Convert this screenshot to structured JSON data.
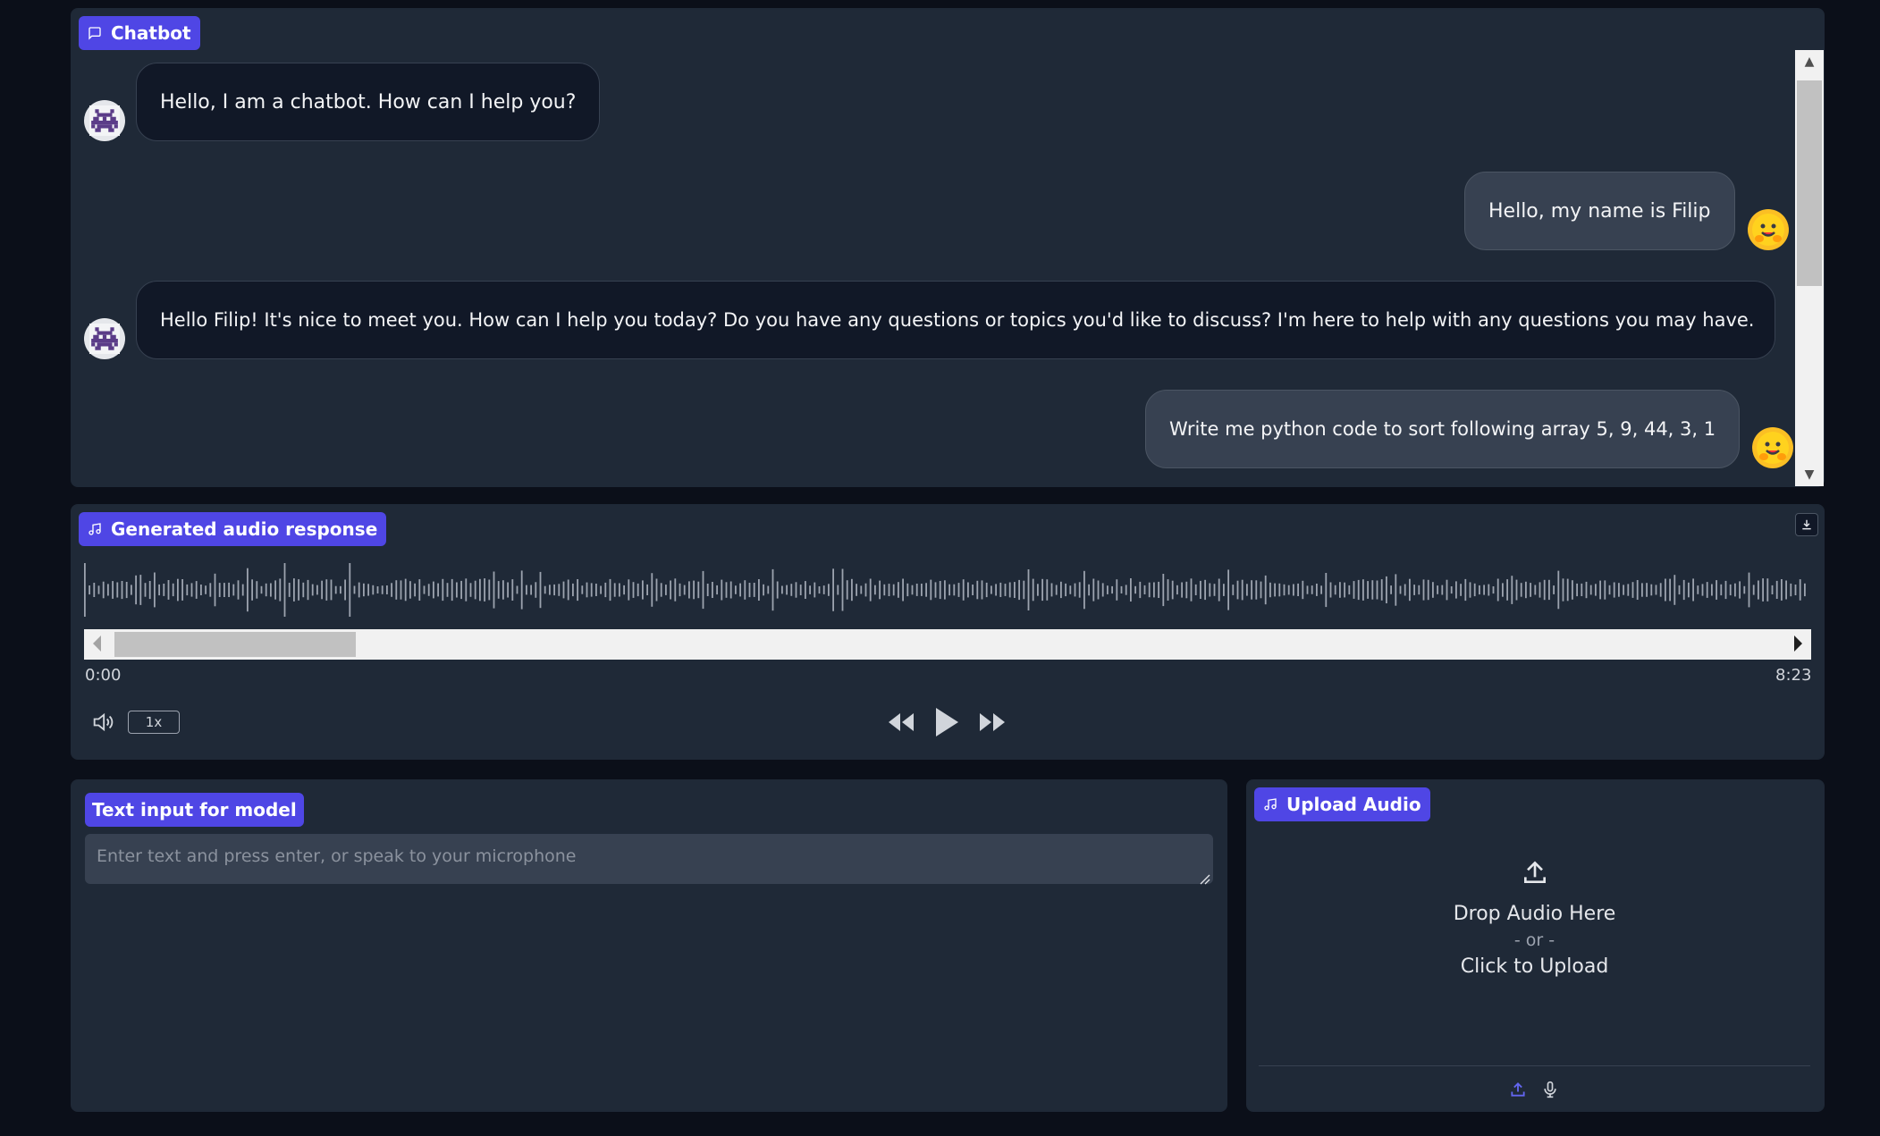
{
  "chatbot": {
    "label": "Chatbot",
    "messages": [
      {
        "role": "bot",
        "text": "Hello, I am a chatbot. How can I help you?"
      },
      {
        "role": "user",
        "text": "Hello, my name is Filip"
      },
      {
        "role": "bot",
        "text": "Hello Filip! It's nice to meet you. How can I help you today? Do you have any questions or topics you'd like to discuss? I'm here to help with any questions you may have."
      },
      {
        "role": "user",
        "text": "Write me python code to sort following array 5, 9, 44, 3, 1"
      }
    ]
  },
  "audio": {
    "label": "Generated audio response",
    "current_time": "0:00",
    "duration": "8:23",
    "playback_rate": "1x",
    "scroll_position_fraction": 0.0
  },
  "text_input": {
    "label": "Text input for model",
    "placeholder": "Enter text and press enter, or speak to your microphone",
    "value": ""
  },
  "upload": {
    "label": "Upload Audio",
    "drop_text": "Drop Audio Here",
    "or_text": "- or -",
    "click_text": "Click to Upload"
  },
  "colors": {
    "accent": "#4f46e5",
    "panel": "#1f2937",
    "background": "#0b0f19"
  }
}
